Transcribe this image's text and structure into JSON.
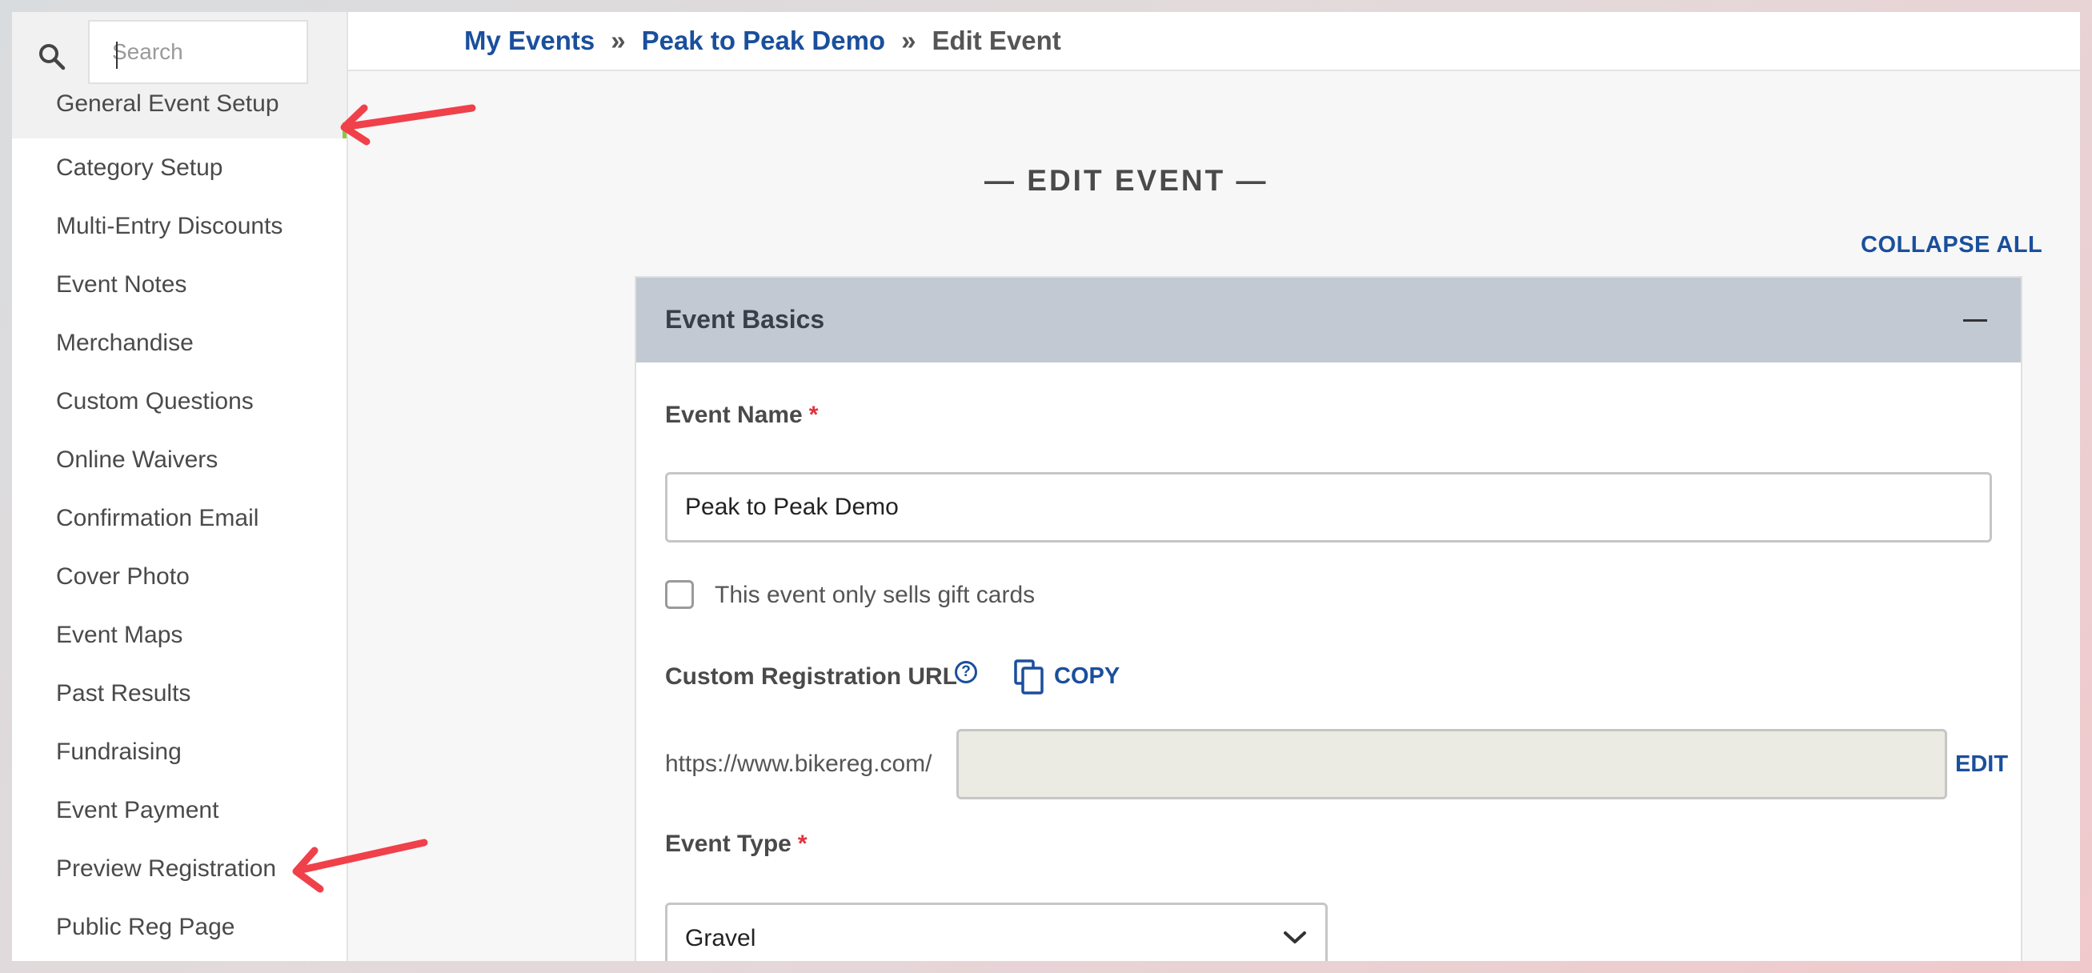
{
  "sidebar": {
    "search": {
      "placeholder": "Search",
      "icon": "search-icon"
    },
    "items": [
      {
        "label": "General Event Setup"
      },
      {
        "label": "Category Setup"
      },
      {
        "label": "Multi-Entry Discounts"
      },
      {
        "label": "Event Notes"
      },
      {
        "label": "Merchandise"
      },
      {
        "label": "Custom Questions"
      },
      {
        "label": "Online Waivers"
      },
      {
        "label": "Confirmation Email"
      },
      {
        "label": "Cover Photo"
      },
      {
        "label": "Event Maps"
      },
      {
        "label": "Past Results"
      },
      {
        "label": "Fundraising"
      },
      {
        "label": "Event Payment"
      },
      {
        "label": "Preview Registration"
      },
      {
        "label": "Public Reg Page"
      }
    ]
  },
  "breadcrumb": {
    "items": [
      "My Events",
      "Peak to Peak Demo",
      "Edit Event"
    ],
    "separator": "»"
  },
  "main": {
    "title": "— EDIT EVENT —",
    "collapse_all": "COLLAPSE ALL",
    "panel": {
      "title": "Event Basics",
      "event_name": {
        "label": "Event Name",
        "required_mark": "*",
        "value": "Peak to Peak Demo"
      },
      "gift_cards_checkbox": {
        "label": "This event only sells gift cards",
        "checked": false
      },
      "custom_url": {
        "label": "Custom Registration URL",
        "help_icon": "?",
        "copy_label": "COPY",
        "prefix": "https://www.bikereg.com/",
        "value": "",
        "edit_label": "EDIT"
      },
      "event_type": {
        "label": "Event Type",
        "required_mark": "*",
        "value": "Gravel"
      }
    }
  },
  "annotations": {
    "arrow_color": "#f0404a"
  },
  "colors": {
    "link": "#1a4f9c",
    "panel_header": "#c2c9d2",
    "required": "#e0333c",
    "active_accent": "#8fc742"
  }
}
